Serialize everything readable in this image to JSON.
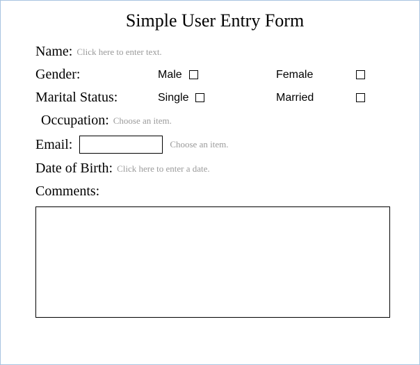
{
  "title": "Simple User Entry Form",
  "fields": {
    "name": {
      "label": "Name:",
      "placeholder": "Click here to enter text."
    },
    "gender": {
      "label": "Gender:",
      "option1": "Male",
      "option2": "Female"
    },
    "marital": {
      "label": "Marital Status:",
      "option1": "Single",
      "option2": "Married"
    },
    "occupation": {
      "label": "Occupation:",
      "placeholder": "Choose an item."
    },
    "email": {
      "label": "Email:",
      "value": "",
      "placeholder": "Choose an item."
    },
    "dob": {
      "label": "Date of Birth:",
      "placeholder": "Click here to enter a date."
    },
    "comments": {
      "label": "Comments:",
      "value": ""
    }
  }
}
